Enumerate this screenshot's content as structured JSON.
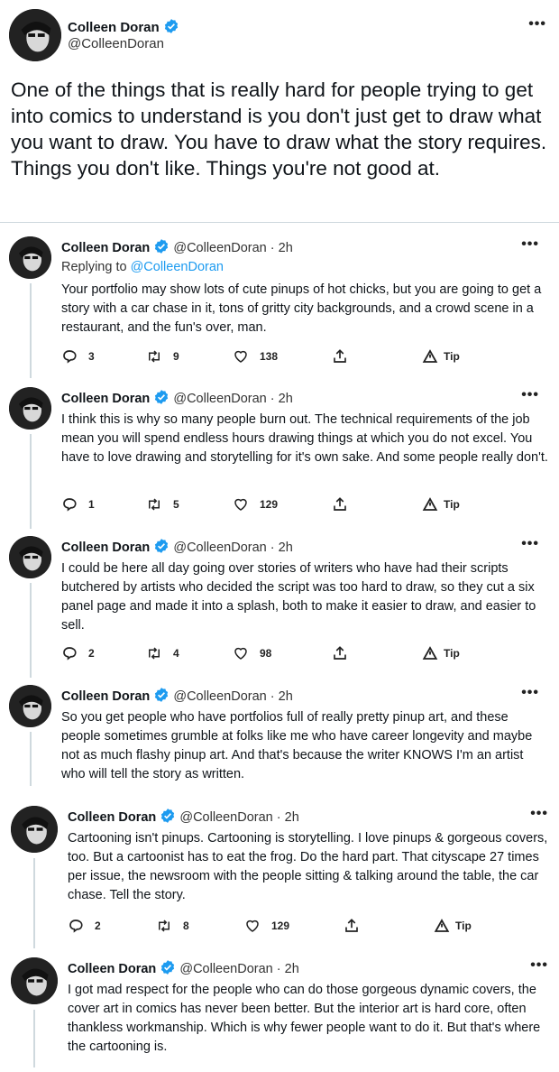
{
  "main_tweet": {
    "name": "Colleen Doran",
    "handle": "@ColleenDoran",
    "text": "One of the things that is really hard for people trying to get into comics to understand is you don't just get to draw what you want to draw. You have to draw what the story requires. Things you don't like. Things you're not good at."
  },
  "replies": [
    {
      "name": "Colleen Doran",
      "handle": "@ColleenDoran · 2h",
      "replying_prefix": "Replying to",
      "replying_handle": "@ColleenDoran",
      "text": "Your portfolio may show lots of cute pinups of hot chicks, but you are going to get a story with a car chase in it, tons of gritty city backgrounds, and a crowd scene in a restaurant, and the fun's over, man.",
      "replies": "3",
      "retweets": "9",
      "likes": "138",
      "tip": "Tip"
    },
    {
      "name": "Colleen Doran",
      "handle": "@ColleenDoran · 2h",
      "text": "I think this is why so many people burn out. The technical requirements of the job mean you will spend endless hours drawing things at which you do not excel. You have to love drawing and storytelling for it's own sake. And some people really don't.",
      "replies": "1",
      "retweets": "5",
      "likes": "129",
      "tip": "Tip"
    },
    {
      "name": "Colleen Doran",
      "handle": "@ColleenDoran · 2h",
      "text": "I could be here all day going over stories of writers who have had their scripts butchered by artists who decided the script was too hard to draw, so they cut a six panel page and made it into a splash, both to make it easier to draw, and easier to sell.",
      "replies": "2",
      "retweets": "4",
      "likes": "98",
      "tip": "Tip"
    },
    {
      "name": "Colleen Doran",
      "handle": "@ColleenDoran · 2h",
      "text": "So you get people who have portfolios full of really pretty pinup art, and these people sometimes grumble at folks like me who have career longevity and maybe not as much flashy pinup art. And that's because the writer KNOWS I'm an artist who will tell the story as written."
    },
    {
      "name": "Colleen Doran",
      "handle": "@ColleenDoran · 2h",
      "text": "Cartooning isn't pinups. Cartooning is storytelling. I love pinups & gorgeous covers, too. But a cartoonist has to eat the frog. Do the hard part. That cityscape 27 times per issue, the newsroom with the people sitting & talking around the table, the car chase. Tell the story.",
      "replies": "2",
      "retweets": "8",
      "likes": "129",
      "tip": "Tip"
    },
    {
      "name": "Colleen Doran",
      "handle": "@ColleenDoran · 2h",
      "text": "I got mad respect for the people who can do those gorgeous dynamic covers, the cover art in comics has never been better. But the interior art is hard core, often thankless workmanship. Which is why fewer people want to do it. But that's where the cartooning is."
    }
  ],
  "more_label": "•••",
  "colors": {
    "accent": "#1d9bf0",
    "text": "#0f1419",
    "line": "#cfd9de"
  },
  "icons": [
    "verified-badge-icon",
    "reply-icon",
    "retweet-icon",
    "like-icon",
    "share-icon",
    "tip-icon",
    "more-icon"
  ]
}
